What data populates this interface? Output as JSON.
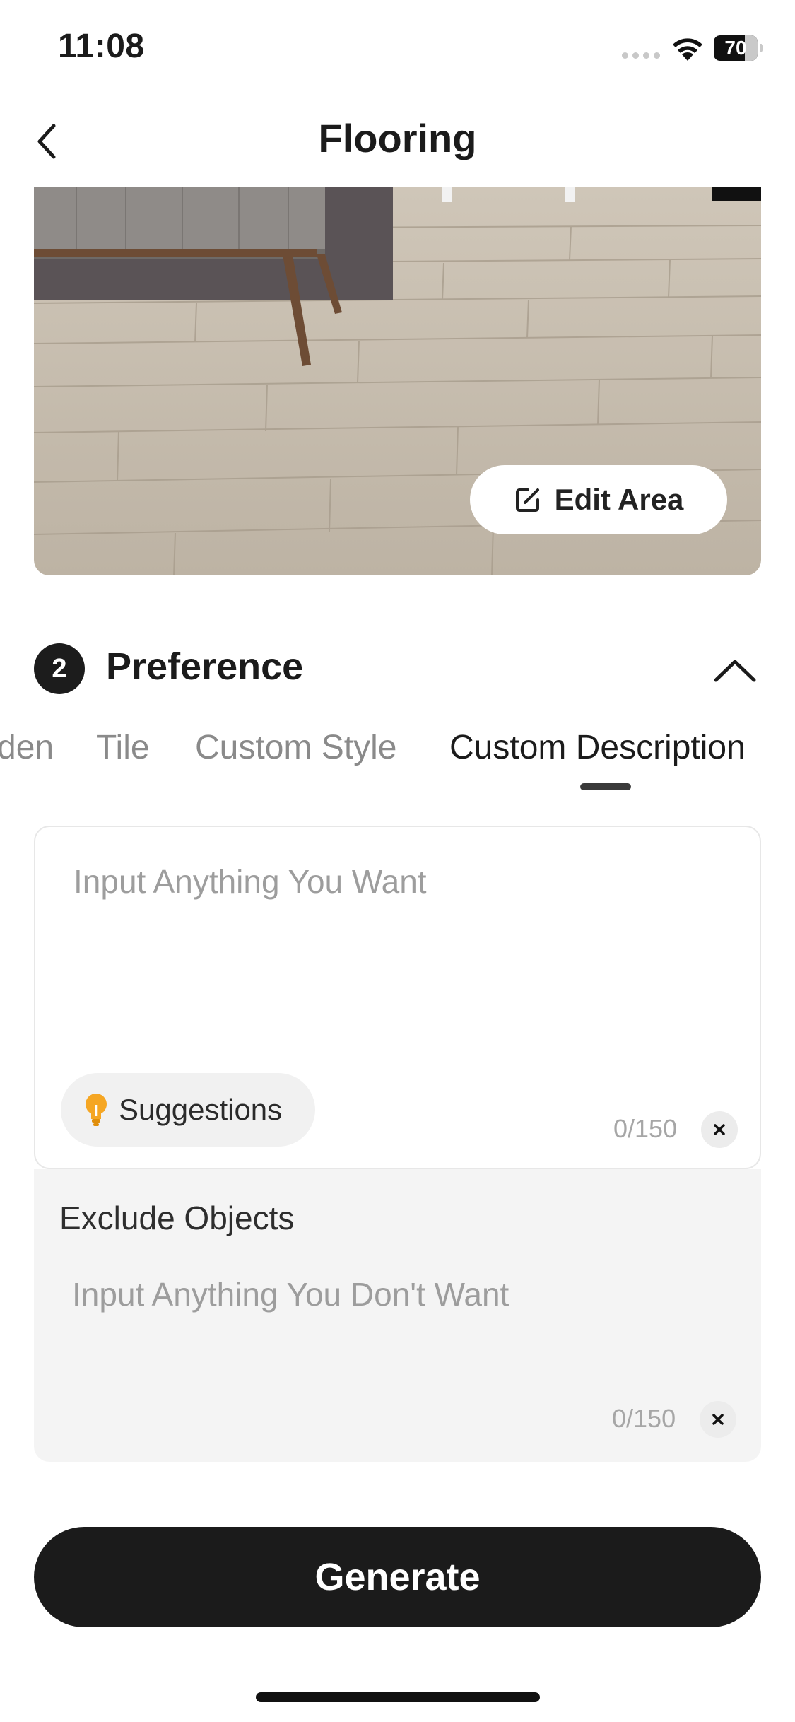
{
  "status_bar": {
    "time": "11:08",
    "battery_level": "70"
  },
  "nav": {
    "title": "Flooring"
  },
  "photo": {
    "edit_area_label": "Edit Area"
  },
  "preference": {
    "step_number": "2",
    "title": "Preference",
    "tabs": [
      {
        "label": "den",
        "active": false
      },
      {
        "label": "Tile",
        "active": false
      },
      {
        "label": "Custom Style",
        "active": false
      },
      {
        "label": "Custom Description",
        "active": true
      }
    ]
  },
  "description": {
    "placeholder": "Input Anything You Want",
    "suggestions_label": "Suggestions",
    "counter": "0/150"
  },
  "exclude": {
    "title": "Exclude Objects",
    "placeholder": "Input Anything You Don't Want",
    "counter": "0/150"
  },
  "generate_label": "Generate"
}
